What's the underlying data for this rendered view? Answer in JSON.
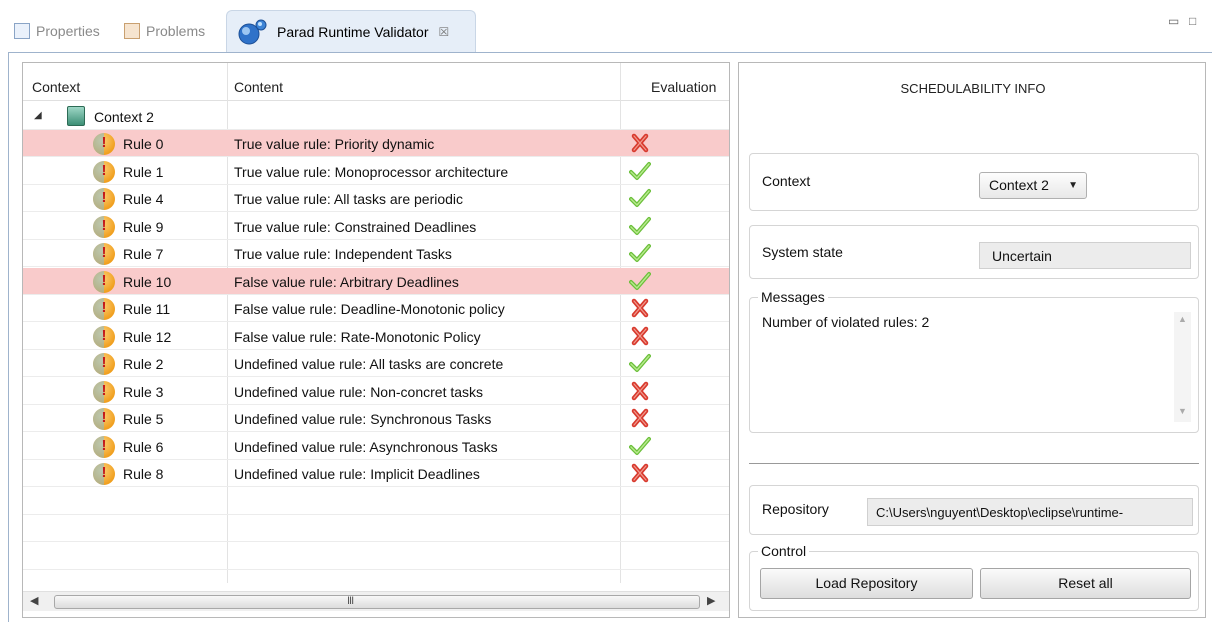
{
  "tabs": {
    "properties": "Properties",
    "problems": "Problems",
    "active": "Parad Runtime Validator",
    "close_glyph": "☒"
  },
  "table": {
    "headers": {
      "context": "Context",
      "content": "Content",
      "evaluation": "Evaluation"
    },
    "context_node": "Context 2",
    "rows": [
      {
        "rule": "Rule 0",
        "content": "True value rule: Priority dynamic",
        "evaluation": "fail",
        "violated": true
      },
      {
        "rule": "Rule 1",
        "content": "True value rule: Monoprocessor architecture",
        "evaluation": "pass",
        "violated": false
      },
      {
        "rule": "Rule 4",
        "content": "True value rule: All tasks are periodic",
        "evaluation": "pass",
        "violated": false
      },
      {
        "rule": "Rule 9",
        "content": "True value rule: Constrained Deadlines",
        "evaluation": "pass",
        "violated": false
      },
      {
        "rule": "Rule 7",
        "content": "True value rule: Independent Tasks",
        "evaluation": "pass",
        "violated": false
      },
      {
        "rule": "Rule 10",
        "content": "False value rule: Arbitrary Deadlines",
        "evaluation": "pass",
        "violated": true
      },
      {
        "rule": "Rule 11",
        "content": "False value rule: Deadline-Monotonic policy",
        "evaluation": "fail",
        "violated": false
      },
      {
        "rule": "Rule 12",
        "content": "False value rule: Rate-Monotonic Policy",
        "evaluation": "fail",
        "violated": false
      },
      {
        "rule": "Rule 2",
        "content": "Undefined value rule: All tasks are concrete",
        "evaluation": "pass",
        "violated": false
      },
      {
        "rule": "Rule 3",
        "content": "Undefined value rule: Non-concret tasks",
        "evaluation": "fail",
        "violated": false
      },
      {
        "rule": "Rule 5",
        "content": "Undefined value rule: Synchronous Tasks",
        "evaluation": "fail",
        "violated": false
      },
      {
        "rule": "Rule 6",
        "content": "Undefined value rule: Asynchronous Tasks",
        "evaluation": "pass",
        "violated": false
      },
      {
        "rule": "Rule 8",
        "content": "Undefined value rule: Implicit Deadlines",
        "evaluation": "fail",
        "violated": false
      }
    ],
    "scroll_thumb_glyph": "III"
  },
  "schedulability": {
    "title": "SCHEDULABILITY INFO",
    "context_label": "Context",
    "context_selected": "Context 2",
    "state_label": "System state",
    "state_value": "Uncertain",
    "messages_legend": "Messages",
    "messages_text": "Number of violated rules: 2",
    "repository_label": "Repository",
    "repository_path": "C:\\Users\\nguyent\\Desktop\\eclipse\\runtime-",
    "control_legend": "Control",
    "load_button": "Load Repository",
    "reset_button": "Reset all"
  },
  "colors": {
    "violated_row": "#f9cbcb",
    "pass_check": "#6bbf3a",
    "fail_cross": "#d83a2e"
  }
}
